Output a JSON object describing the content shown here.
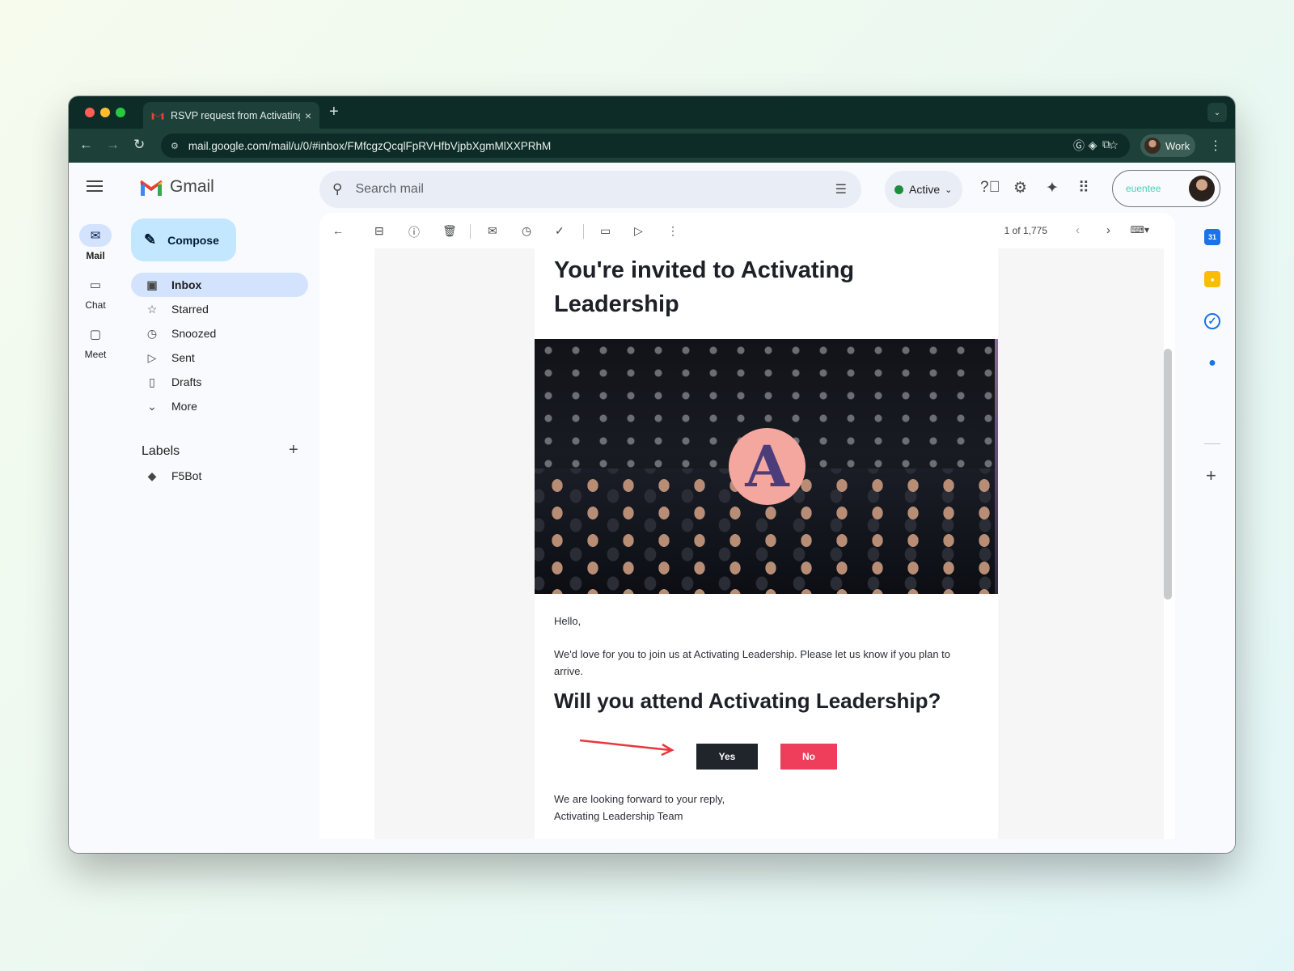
{
  "browser": {
    "tab_title": "RSVP request from Activating",
    "tab_close": "×",
    "new_tab": "+",
    "url": "mail.google.com/mail/u/0/#inbox/FMfcgzQcqlFpRVHfbVjpbXgmMlXXPRhM",
    "profile_label": "Work",
    "menu_glyph": "⋮"
  },
  "gmail": {
    "brand": "Gmail",
    "rail": [
      {
        "label": "Mail",
        "icon": "mail-icon"
      },
      {
        "label": "Chat",
        "icon": "chat-icon"
      },
      {
        "label": "Meet",
        "icon": "video-icon"
      }
    ],
    "compose_label": "Compose",
    "nav": [
      {
        "label": "Inbox",
        "icon": "inbox-icon"
      },
      {
        "label": "Starred",
        "icon": "star-icon"
      },
      {
        "label": "Snoozed",
        "icon": "clock-icon"
      },
      {
        "label": "Sent",
        "icon": "send-icon"
      },
      {
        "label": "Drafts",
        "icon": "draft-icon"
      },
      {
        "label": "More",
        "icon": "chevron-down-icon"
      }
    ],
    "labels_heading": "Labels",
    "labels": [
      {
        "label": "F5Bot",
        "icon": "label-icon"
      }
    ],
    "search_placeholder": "Search mail",
    "status": "Active",
    "account_brand": "euentee"
  },
  "toolbar": {
    "pager": "1 of 1,775"
  },
  "email": {
    "title": "You're invited to Activating Leadership",
    "logo_letter": "A",
    "greeting": "Hello,",
    "body": "We'd love for you to join us at Activating Leadership. Please let us know if you plan to arrive.",
    "question": "Will you attend Activating Leadership?",
    "yes_label": "Yes",
    "no_label": "No",
    "closing": "We are looking forward to your reply,",
    "signature": "Activating Leadership Team"
  },
  "colors": {
    "chrome_dark": "#0d2c27",
    "chrome_mid": "#1d4039",
    "compose_bg": "#c2e7ff",
    "nav_active": "#d3e3fd",
    "yes_button": "#1f252b",
    "no_button": "#ef3e5c",
    "annotation_arrow": "#e8383d"
  }
}
